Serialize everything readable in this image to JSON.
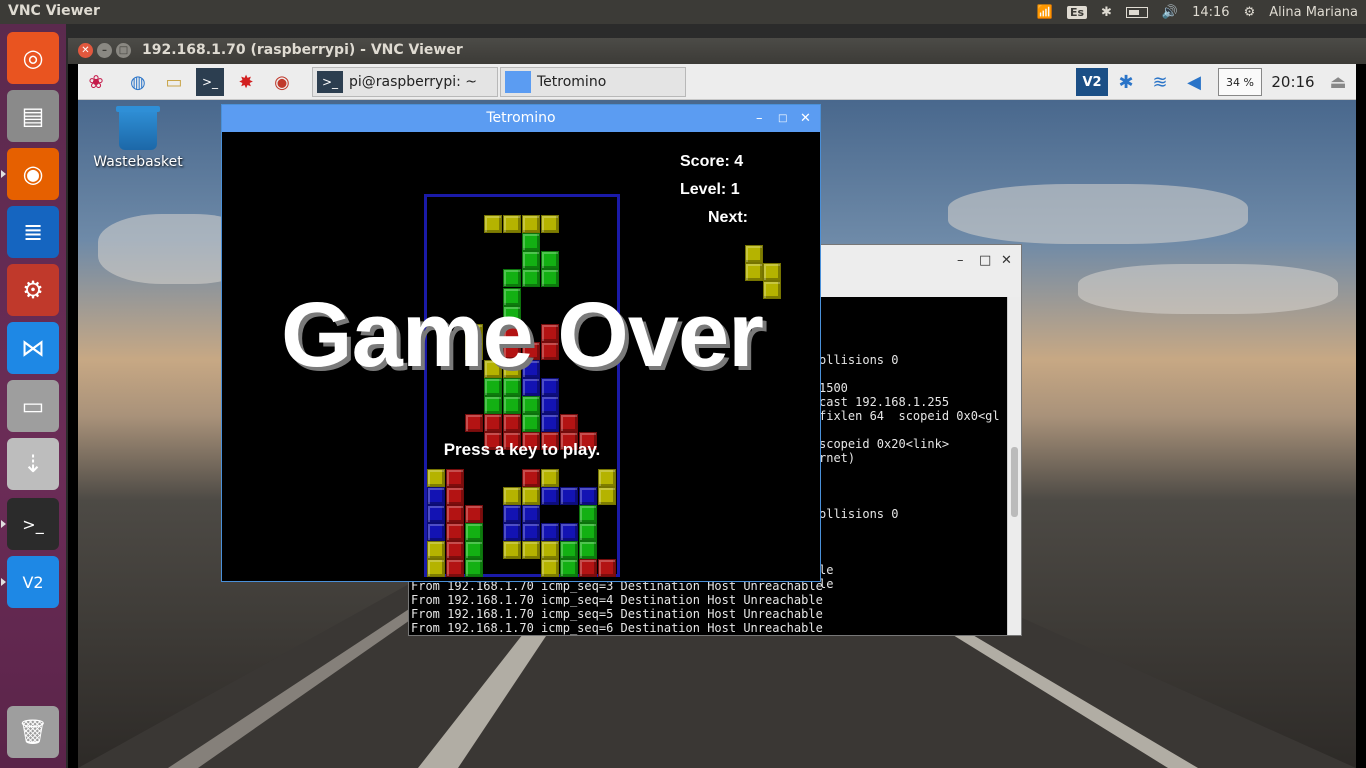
{
  "top_panel": {
    "app_title": "VNC Viewer",
    "keyboard_layout": "Es",
    "time": "14:16",
    "user": "Alina Mariana"
  },
  "launcher": {
    "items": [
      {
        "name": "dash-home",
        "icon": "ubuntu-logo-icon",
        "color": "#e95420"
      },
      {
        "name": "files",
        "icon": "file-cabinet-icon",
        "color": "#8a8a8a"
      },
      {
        "name": "firefox",
        "icon": "firefox-icon",
        "color": "#e66000"
      },
      {
        "name": "writer",
        "icon": "document-icon",
        "color": "#1565c0"
      },
      {
        "name": "system-settings",
        "icon": "wrench-gear-icon",
        "color": "#c0392b"
      },
      {
        "name": "vscode",
        "icon": "vscode-icon",
        "color": "#1e88e5"
      },
      {
        "name": "disks",
        "icon": "drive-icon",
        "color": "#9e9e9e"
      },
      {
        "name": "usb-creator",
        "icon": "usb-icon",
        "color": "#bdbdbd"
      },
      {
        "name": "terminal",
        "icon": "terminal-icon",
        "color": "#2b2b2b"
      },
      {
        "name": "vnc-viewer",
        "icon": "vnc-icon",
        "color": "#1e88e5"
      },
      {
        "name": "trash",
        "icon": "trash-icon",
        "color": "#9e9e9e"
      }
    ]
  },
  "vnc_window": {
    "title": "192.168.1.70 (raspberrypi) - VNC Viewer"
  },
  "pi_taskbar": {
    "terminal_task": "pi@raspberrypi: ~",
    "tetromino_task": "Tetromino",
    "cpu": "34 %",
    "clock": "20:16"
  },
  "desktop": {
    "wastebasket_label": "Wastebasket"
  },
  "terminal": {
    "right_lines": [
      {
        "row": 3,
        "text": "ollisions 0"
      },
      {
        "row": 5,
        "text": "1500"
      },
      {
        "row": 6,
        "text": "cast 192.168.1.255"
      },
      {
        "row": 7,
        "text": "fixlen 64  scopeid 0x0<gl"
      },
      {
        "row": 9,
        "text": "scopeid 0x20<link>"
      },
      {
        "row": 10,
        "text": "rnet)"
      },
      {
        "row": 14,
        "text": "ollisions 0"
      },
      {
        "row": 18,
        "text": "le"
      },
      {
        "row": 19,
        "text": "le"
      }
    ],
    "bottom_lines": [
      "From 192.168.1.70 icmp_seq=3 Destination Host Unreachable",
      "From 192.168.1.70 icmp_seq=4 Destination Host Unreachable",
      "From 192.168.1.70 icmp_seq=5 Destination Host Unreachable",
      "From 192.168.1.70 icmp_seq=6 Destination Host Unreachable"
    ]
  },
  "tetromino": {
    "window_title": "Tetromino",
    "score_text": "Score: 4",
    "level_text": "Level: 1",
    "next_label": "Next:",
    "game_over": "Game Over",
    "press_key": "Press a key to play.",
    "colors": {
      "Y": "#b5b300",
      "G": "#13b013",
      "R": "#b31313",
      "B": "#1313b3"
    },
    "board_rows": [
      "..........",
      "...YYYY...",
      ".....G....",
      ".....GG...",
      "....GGG...",
      "....G.....",
      "....G.....",
      "..Y.R.R...",
      "..Y.RRR...",
      "...YYB....",
      "...GGBB...",
      "...GGGB...",
      "..RRRGBR..",
      "...RRRRRR.",
      "..........",
      "YR...RY..Y",
      "BR..YYBBBY",
      "BRR.BB..G.",
      "BRG.BBBBG.",
      "YRG.YYYGG.",
      "YRG...YGRR"
    ],
    "next_piece": [
      "Y.",
      "YY",
      ".Y"
    ]
  }
}
